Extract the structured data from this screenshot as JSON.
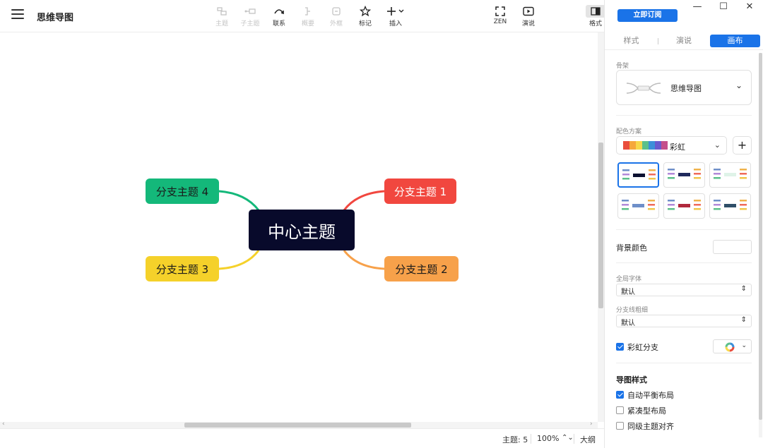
{
  "app": {
    "title": "思维导图"
  },
  "toolbar": {
    "tools": [
      {
        "label": "主题",
        "icon": "topic-icon",
        "enabled": false
      },
      {
        "label": "子主题",
        "icon": "subtopic-icon",
        "enabled": false
      },
      {
        "label": "联系",
        "icon": "relationship-icon",
        "enabled": true
      },
      {
        "label": "概要",
        "icon": "summary-icon",
        "enabled": false
      },
      {
        "label": "外框",
        "icon": "boundary-icon",
        "enabled": false
      },
      {
        "label": "标记",
        "icon": "star-icon",
        "enabled": true
      },
      {
        "label": "插入",
        "icon": "plus-icon",
        "enabled": true
      },
      {
        "label": "ZEN",
        "icon": "fullscreen-icon",
        "enabled": true
      },
      {
        "label": "演说",
        "icon": "play-icon",
        "enabled": true
      },
      {
        "label": "格式",
        "icon": "panel-icon",
        "enabled": true
      }
    ]
  },
  "map": {
    "central": "中心主题",
    "branches": [
      {
        "label": "分支主题 1",
        "color": "#f1473f"
      },
      {
        "label": "分支主题 2",
        "color": "#f7a14a"
      },
      {
        "label": "分支主题 3",
        "color": "#f5d12a"
      },
      {
        "label": "分支主题 4",
        "color": "#14b87a"
      }
    ]
  },
  "status": {
    "topics": "主题: 5",
    "zoom": "100%",
    "outline": "大纲"
  },
  "panel": {
    "subscribe": "立即订阅",
    "window_controls": [
      "—",
      "☐",
      "✕"
    ],
    "tabs": [
      {
        "label": "样式",
        "active": false
      },
      {
        "label": "演说",
        "active": false
      },
      {
        "label": "画布",
        "active": true
      }
    ],
    "skeleton": {
      "label": "骨架",
      "value": "思维导图"
    },
    "palette": {
      "label": "配色方案",
      "value": "彩虹",
      "colors": [
        "#e94e3c",
        "#f6a73b",
        "#f7d84a",
        "#5cc08b",
        "#3d8fd9",
        "#6a5acd",
        "#c44f8b"
      ]
    },
    "background": {
      "label": "背景颜色"
    },
    "font": {
      "label": "全局字体",
      "value": "默认"
    },
    "line": {
      "label": "分支线粗细",
      "value": "默认"
    },
    "rainbow_branch": {
      "label": "彩虹分支",
      "checked": true
    },
    "map_style": {
      "title": "导图样式",
      "options": [
        {
          "label": "自动平衡布局",
          "checked": true
        },
        {
          "label": "紧凑型布局",
          "checked": false
        },
        {
          "label": "同级主题对齐",
          "checked": false
        }
      ]
    }
  },
  "colors": {
    "accent": "#1a73e8",
    "central_bg": "#080a2b"
  }
}
